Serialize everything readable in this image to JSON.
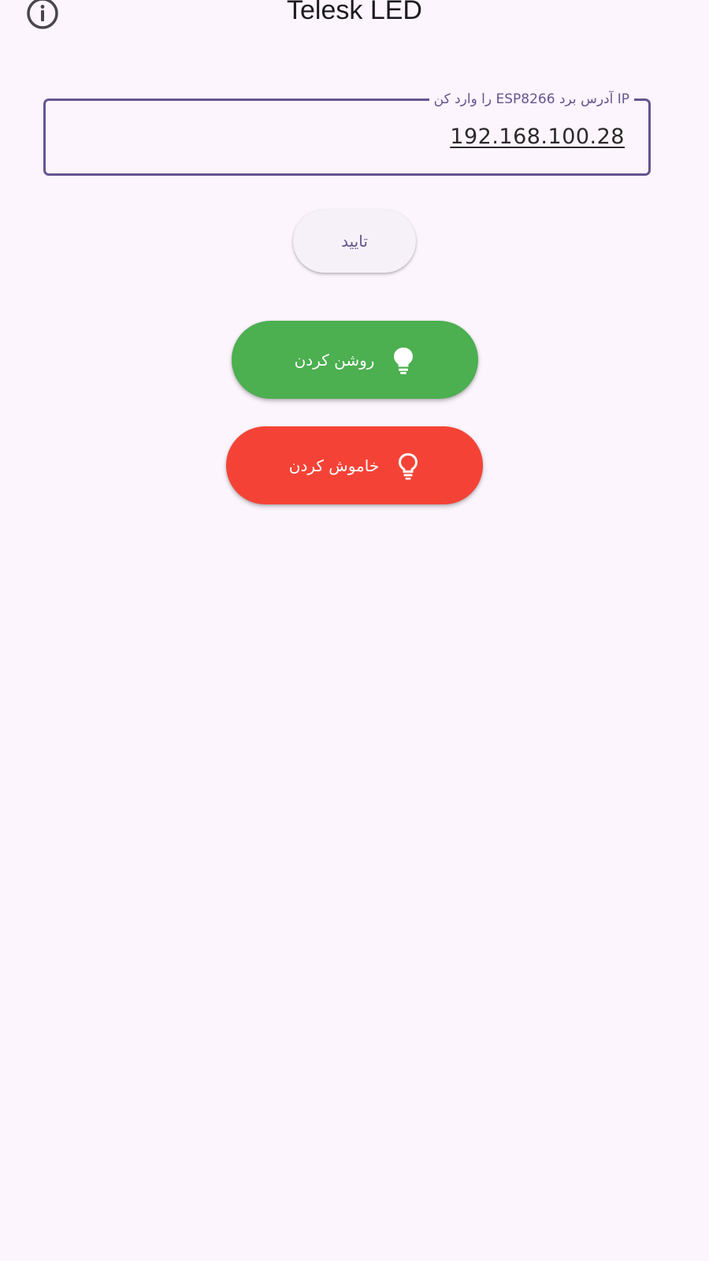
{
  "app_bar": {
    "title": "Telesk LED",
    "info_icon": "info-circle-icon"
  },
  "ip_field": {
    "label": "IP آدرس برد ESP8266 را وارد کن",
    "value": "192.168.100.28"
  },
  "confirm_button": {
    "label": "تایید"
  },
  "on_button": {
    "label": "روشن کردن",
    "icon": "lightbulb-filled-icon",
    "color": "#4caf50"
  },
  "off_button": {
    "label": "خاموش کردن",
    "icon": "lightbulb-outline-icon",
    "color": "#f44336"
  },
  "colors": {
    "background": "#fcf5fd",
    "accent": "#65558f"
  }
}
